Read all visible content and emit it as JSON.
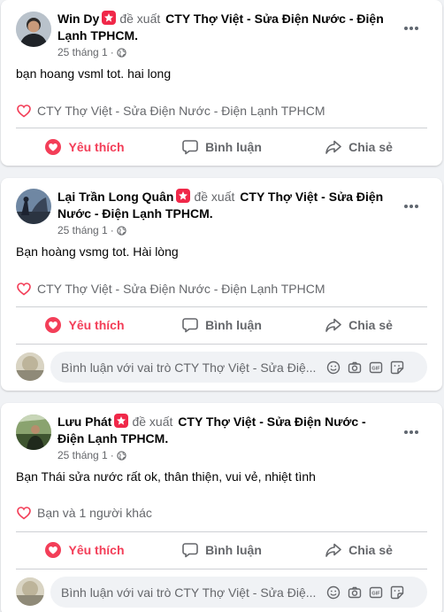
{
  "colors": {
    "like_red": "#f33e58",
    "badge_red": "#f02849",
    "secondary_text": "#65676b",
    "feed_bg": "#f0f2f5"
  },
  "posts": [
    {
      "author": "Win Dy",
      "verb": "đề xuất",
      "page": "CTY Thợ Việt - Sửa Điện Nước - Điện Lạnh TPHCM.",
      "date": "25 tháng 1",
      "dot": "·",
      "text": "bạn hoang vsml tot. hai long",
      "reaction_text": "CTY Thợ Việt - Sửa Điện Nước - Điện Lạnh TPHCM",
      "like": "Yêu thích",
      "comment": "Bình luận",
      "share": "Chia sẻ"
    },
    {
      "author": "Lại Trần Long Quân",
      "verb": "đề xuất",
      "page": "CTY Thợ Việt - Sửa Điện Nước - Điện Lạnh TPHCM.",
      "date": "25 tháng 1",
      "dot": "·",
      "text": "Bạn hoàng vsmg tot. Hài lòng",
      "reaction_text": "CTY Thợ Việt - Sửa Điện Nước - Điện Lạnh TPHCM",
      "like": "Yêu thích",
      "comment": "Bình luận",
      "share": "Chia sẻ",
      "comment_placeholder": "Bình luận với vai trò CTY Thợ Việt - Sửa Điệ..."
    },
    {
      "author": "Lưu Phát",
      "verb": "đề xuất",
      "page": "CTY Thợ Việt - Sửa Điện Nước - Điện Lạnh TPHCM.",
      "date": "25 tháng 1",
      "dot": "·",
      "text": "Bạn Thái sửa nước rất ok, thân thiện, vui vẻ, nhiệt tình",
      "reaction_text": "Bạn và 1 người khác",
      "like": "Yêu thích",
      "comment": "Bình luận",
      "share": "Chia sẻ",
      "comment_placeholder": "Bình luận với vai trò CTY Thợ Việt - Sửa Điệ..."
    }
  ],
  "icons": {
    "like": "heart-icon",
    "comment": "speech-bubble-icon",
    "share": "share-arrow-icon",
    "more": "more-options-icon",
    "privacy": "globe-icon",
    "recommend": "recommend-badge-icon",
    "emoji": "emoji-icon",
    "camera": "camera-icon",
    "gif": "gif-icon",
    "sticker": "sticker-icon"
  }
}
